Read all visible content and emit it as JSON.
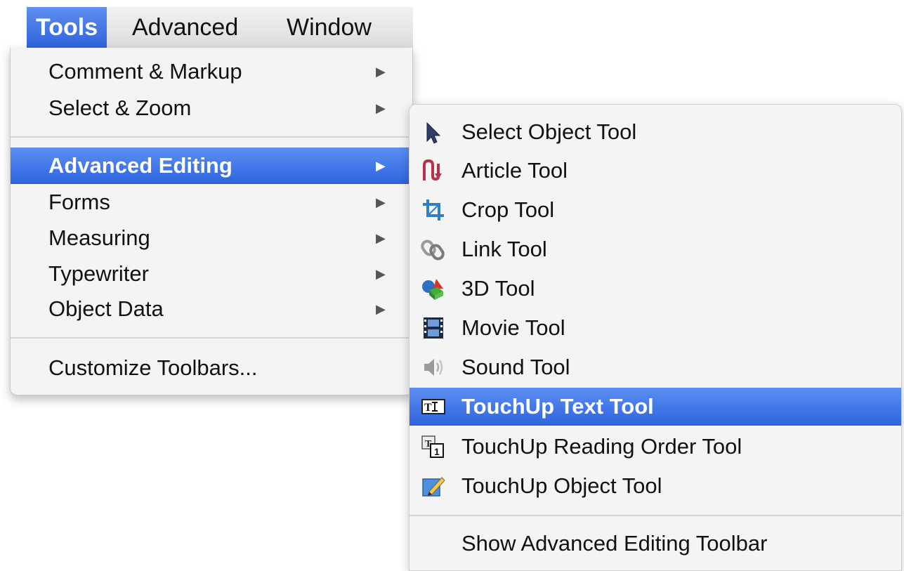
{
  "menubar": {
    "items": [
      "Tools",
      "Advanced",
      "Window"
    ]
  },
  "tools_menu": {
    "items": [
      {
        "label": "Comment & Markup",
        "has_submenu": true
      },
      {
        "label": "Select & Zoom",
        "has_submenu": true
      },
      {
        "label": "Advanced Editing",
        "has_submenu": true,
        "highlighted": true
      },
      {
        "label": "Forms",
        "has_submenu": true
      },
      {
        "label": "Measuring",
        "has_submenu": true
      },
      {
        "label": "Typewriter",
        "has_submenu": true
      },
      {
        "label": "Object Data",
        "has_submenu": true
      },
      {
        "label": "Customize Toolbars...",
        "has_submenu": false
      }
    ]
  },
  "advanced_editing_submenu": {
    "items": [
      {
        "label": "Select Object Tool",
        "icon": "arrow-pointer-icon"
      },
      {
        "label": "Article Tool",
        "icon": "article-icon"
      },
      {
        "label": "Crop Tool",
        "icon": "crop-icon"
      },
      {
        "label": "Link Tool",
        "icon": "link-icon"
      },
      {
        "label": "3D Tool",
        "icon": "3d-icon"
      },
      {
        "label": "Movie Tool",
        "icon": "film-icon"
      },
      {
        "label": "Sound Tool",
        "icon": "speaker-icon"
      },
      {
        "label": "TouchUp Text Tool",
        "icon": "touchup-text-icon",
        "highlighted": true
      },
      {
        "label": "TouchUp Reading Order Tool",
        "icon": "reading-order-icon"
      },
      {
        "label": "TouchUp Object Tool",
        "icon": "touchup-object-icon"
      },
      {
        "label": "Show Advanced Editing Toolbar",
        "icon": ""
      }
    ]
  },
  "colors": {
    "highlight": "#3a6fe3",
    "menu_bg": "#f4f4f4"
  }
}
